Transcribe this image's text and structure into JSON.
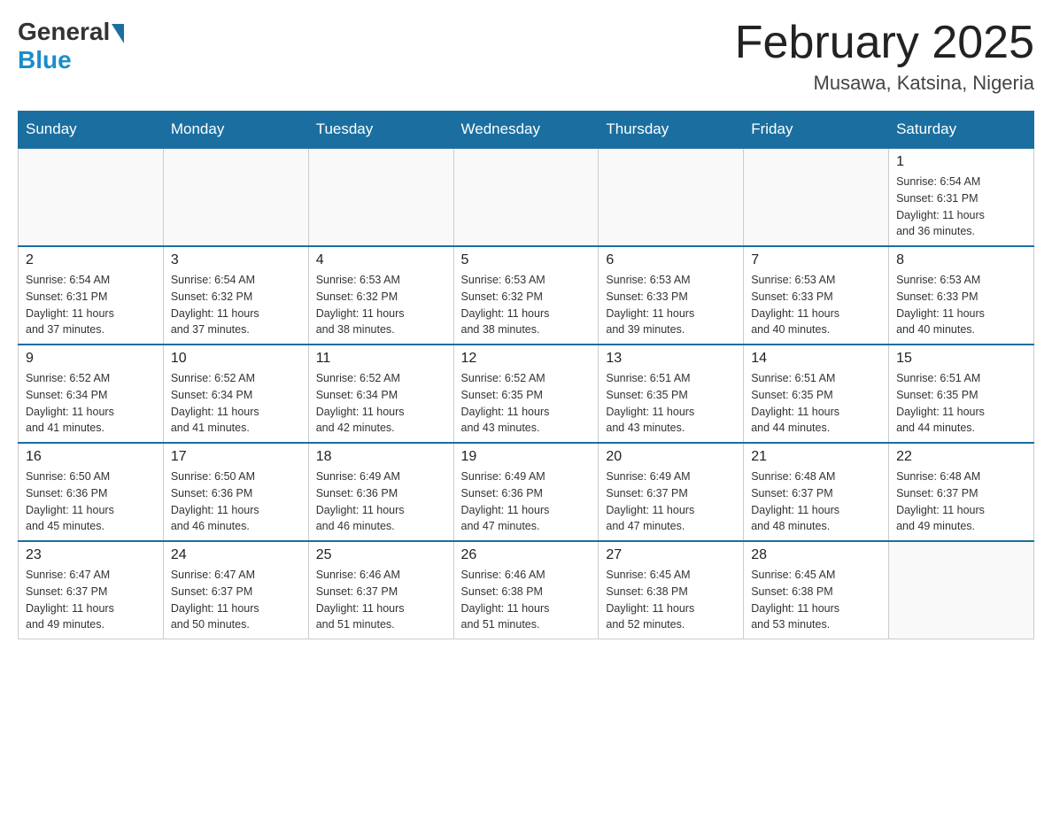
{
  "header": {
    "logo_general": "General",
    "logo_blue": "Blue",
    "title": "February 2025",
    "subtitle": "Musawa, Katsina, Nigeria"
  },
  "days_of_week": [
    "Sunday",
    "Monday",
    "Tuesday",
    "Wednesday",
    "Thursday",
    "Friday",
    "Saturday"
  ],
  "weeks": [
    [
      {
        "day": "",
        "info": ""
      },
      {
        "day": "",
        "info": ""
      },
      {
        "day": "",
        "info": ""
      },
      {
        "day": "",
        "info": ""
      },
      {
        "day": "",
        "info": ""
      },
      {
        "day": "",
        "info": ""
      },
      {
        "day": "1",
        "info": "Sunrise: 6:54 AM\nSunset: 6:31 PM\nDaylight: 11 hours\nand 36 minutes."
      }
    ],
    [
      {
        "day": "2",
        "info": "Sunrise: 6:54 AM\nSunset: 6:31 PM\nDaylight: 11 hours\nand 37 minutes."
      },
      {
        "day": "3",
        "info": "Sunrise: 6:54 AM\nSunset: 6:32 PM\nDaylight: 11 hours\nand 37 minutes."
      },
      {
        "day": "4",
        "info": "Sunrise: 6:53 AM\nSunset: 6:32 PM\nDaylight: 11 hours\nand 38 minutes."
      },
      {
        "day": "5",
        "info": "Sunrise: 6:53 AM\nSunset: 6:32 PM\nDaylight: 11 hours\nand 38 minutes."
      },
      {
        "day": "6",
        "info": "Sunrise: 6:53 AM\nSunset: 6:33 PM\nDaylight: 11 hours\nand 39 minutes."
      },
      {
        "day": "7",
        "info": "Sunrise: 6:53 AM\nSunset: 6:33 PM\nDaylight: 11 hours\nand 40 minutes."
      },
      {
        "day": "8",
        "info": "Sunrise: 6:53 AM\nSunset: 6:33 PM\nDaylight: 11 hours\nand 40 minutes."
      }
    ],
    [
      {
        "day": "9",
        "info": "Sunrise: 6:52 AM\nSunset: 6:34 PM\nDaylight: 11 hours\nand 41 minutes."
      },
      {
        "day": "10",
        "info": "Sunrise: 6:52 AM\nSunset: 6:34 PM\nDaylight: 11 hours\nand 41 minutes."
      },
      {
        "day": "11",
        "info": "Sunrise: 6:52 AM\nSunset: 6:34 PM\nDaylight: 11 hours\nand 42 minutes."
      },
      {
        "day": "12",
        "info": "Sunrise: 6:52 AM\nSunset: 6:35 PM\nDaylight: 11 hours\nand 43 minutes."
      },
      {
        "day": "13",
        "info": "Sunrise: 6:51 AM\nSunset: 6:35 PM\nDaylight: 11 hours\nand 43 minutes."
      },
      {
        "day": "14",
        "info": "Sunrise: 6:51 AM\nSunset: 6:35 PM\nDaylight: 11 hours\nand 44 minutes."
      },
      {
        "day": "15",
        "info": "Sunrise: 6:51 AM\nSunset: 6:35 PM\nDaylight: 11 hours\nand 44 minutes."
      }
    ],
    [
      {
        "day": "16",
        "info": "Sunrise: 6:50 AM\nSunset: 6:36 PM\nDaylight: 11 hours\nand 45 minutes."
      },
      {
        "day": "17",
        "info": "Sunrise: 6:50 AM\nSunset: 6:36 PM\nDaylight: 11 hours\nand 46 minutes."
      },
      {
        "day": "18",
        "info": "Sunrise: 6:49 AM\nSunset: 6:36 PM\nDaylight: 11 hours\nand 46 minutes."
      },
      {
        "day": "19",
        "info": "Sunrise: 6:49 AM\nSunset: 6:36 PM\nDaylight: 11 hours\nand 47 minutes."
      },
      {
        "day": "20",
        "info": "Sunrise: 6:49 AM\nSunset: 6:37 PM\nDaylight: 11 hours\nand 47 minutes."
      },
      {
        "day": "21",
        "info": "Sunrise: 6:48 AM\nSunset: 6:37 PM\nDaylight: 11 hours\nand 48 minutes."
      },
      {
        "day": "22",
        "info": "Sunrise: 6:48 AM\nSunset: 6:37 PM\nDaylight: 11 hours\nand 49 minutes."
      }
    ],
    [
      {
        "day": "23",
        "info": "Sunrise: 6:47 AM\nSunset: 6:37 PM\nDaylight: 11 hours\nand 49 minutes."
      },
      {
        "day": "24",
        "info": "Sunrise: 6:47 AM\nSunset: 6:37 PM\nDaylight: 11 hours\nand 50 minutes."
      },
      {
        "day": "25",
        "info": "Sunrise: 6:46 AM\nSunset: 6:37 PM\nDaylight: 11 hours\nand 51 minutes."
      },
      {
        "day": "26",
        "info": "Sunrise: 6:46 AM\nSunset: 6:38 PM\nDaylight: 11 hours\nand 51 minutes."
      },
      {
        "day": "27",
        "info": "Sunrise: 6:45 AM\nSunset: 6:38 PM\nDaylight: 11 hours\nand 52 minutes."
      },
      {
        "day": "28",
        "info": "Sunrise: 6:45 AM\nSunset: 6:38 PM\nDaylight: 11 hours\nand 53 minutes."
      },
      {
        "day": "",
        "info": ""
      }
    ]
  ]
}
